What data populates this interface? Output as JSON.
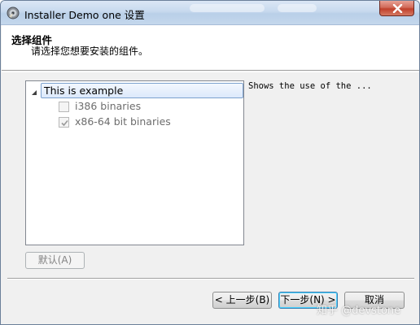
{
  "window": {
    "title": "Installer Demo one 设置"
  },
  "header": {
    "title": "选择组件",
    "subtitle": "请选择您想要安装的组件。"
  },
  "tree": {
    "root": {
      "label": "This is  example",
      "expanded": true
    },
    "children": [
      {
        "label": "i386 binaries",
        "checked": false
      },
      {
        "label": "x86-64 bit binaries",
        "checked": true
      }
    ]
  },
  "description": {
    "text": "Shows the use of the ..."
  },
  "buttons": {
    "default": "默认(A)",
    "back": "< 上一步(B)",
    "next": "下一步(N) >",
    "cancel": "取消"
  },
  "watermark": {
    "text": "知乎 @devstone"
  },
  "colors": {
    "selection_border": "#7da2ce",
    "focus_border": "#3c7fb1",
    "close_button": "#c1402b"
  },
  "icons": {
    "app": "installer-disc-icon",
    "close": "close-icon",
    "expander": "tree-expanded-triangle-icon"
  }
}
